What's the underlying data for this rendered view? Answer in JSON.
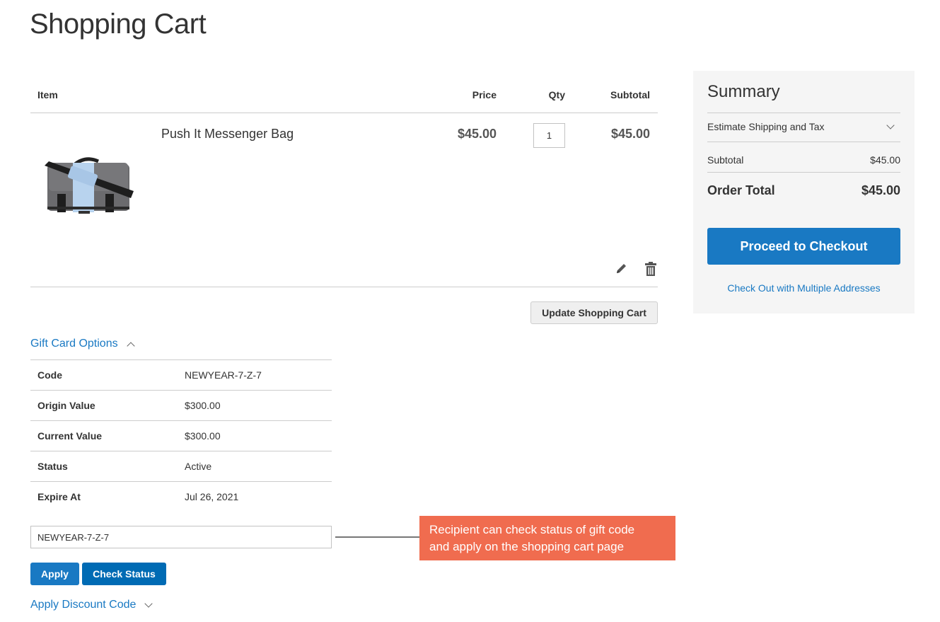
{
  "page": {
    "title": "Shopping Cart"
  },
  "cart": {
    "headers": {
      "item": "Item",
      "price": "Price",
      "qty": "Qty",
      "subtotal": "Subtotal"
    },
    "items": [
      {
        "name": "Push It Messenger Bag",
        "price": "$45.00",
        "qty": "1",
        "subtotal": "$45.00",
        "image": "messenger-bag-image"
      }
    ],
    "update_label": "Update Shopping Cart"
  },
  "gift_card": {
    "toggle_label": "Gift Card Options",
    "rows": [
      {
        "label": "Code",
        "value": "NEWYEAR-7-Z-7"
      },
      {
        "label": "Origin Value",
        "value": "$300.00"
      },
      {
        "label": "Current Value",
        "value": "$300.00"
      },
      {
        "label": "Status",
        "value": "Active"
      },
      {
        "label": "Expire At",
        "value": "Jul 26, 2021"
      }
    ],
    "input_value": "NEWYEAR-7-Z-7",
    "apply_label": "Apply",
    "check_status_label": "Check Status"
  },
  "discount": {
    "toggle_label": "Apply Discount Code"
  },
  "annotation": {
    "line1": "Recipient can check status of gift code",
    "line2": "and apply on the shopping cart page",
    "color": "#f06c4f"
  },
  "summary": {
    "title": "Summary",
    "estimate_label": "Estimate Shipping and Tax",
    "subtotal_label": "Subtotal",
    "subtotal_value": "$45.00",
    "total_label": "Order Total",
    "total_value": "$45.00",
    "checkout_label": "Proceed to Checkout",
    "multi_address_label": "Check Out with Multiple Addresses"
  },
  "colors": {
    "primary": "#1979c3",
    "primary_dark": "#006bb4",
    "summary_bg": "#f5f5f5"
  }
}
